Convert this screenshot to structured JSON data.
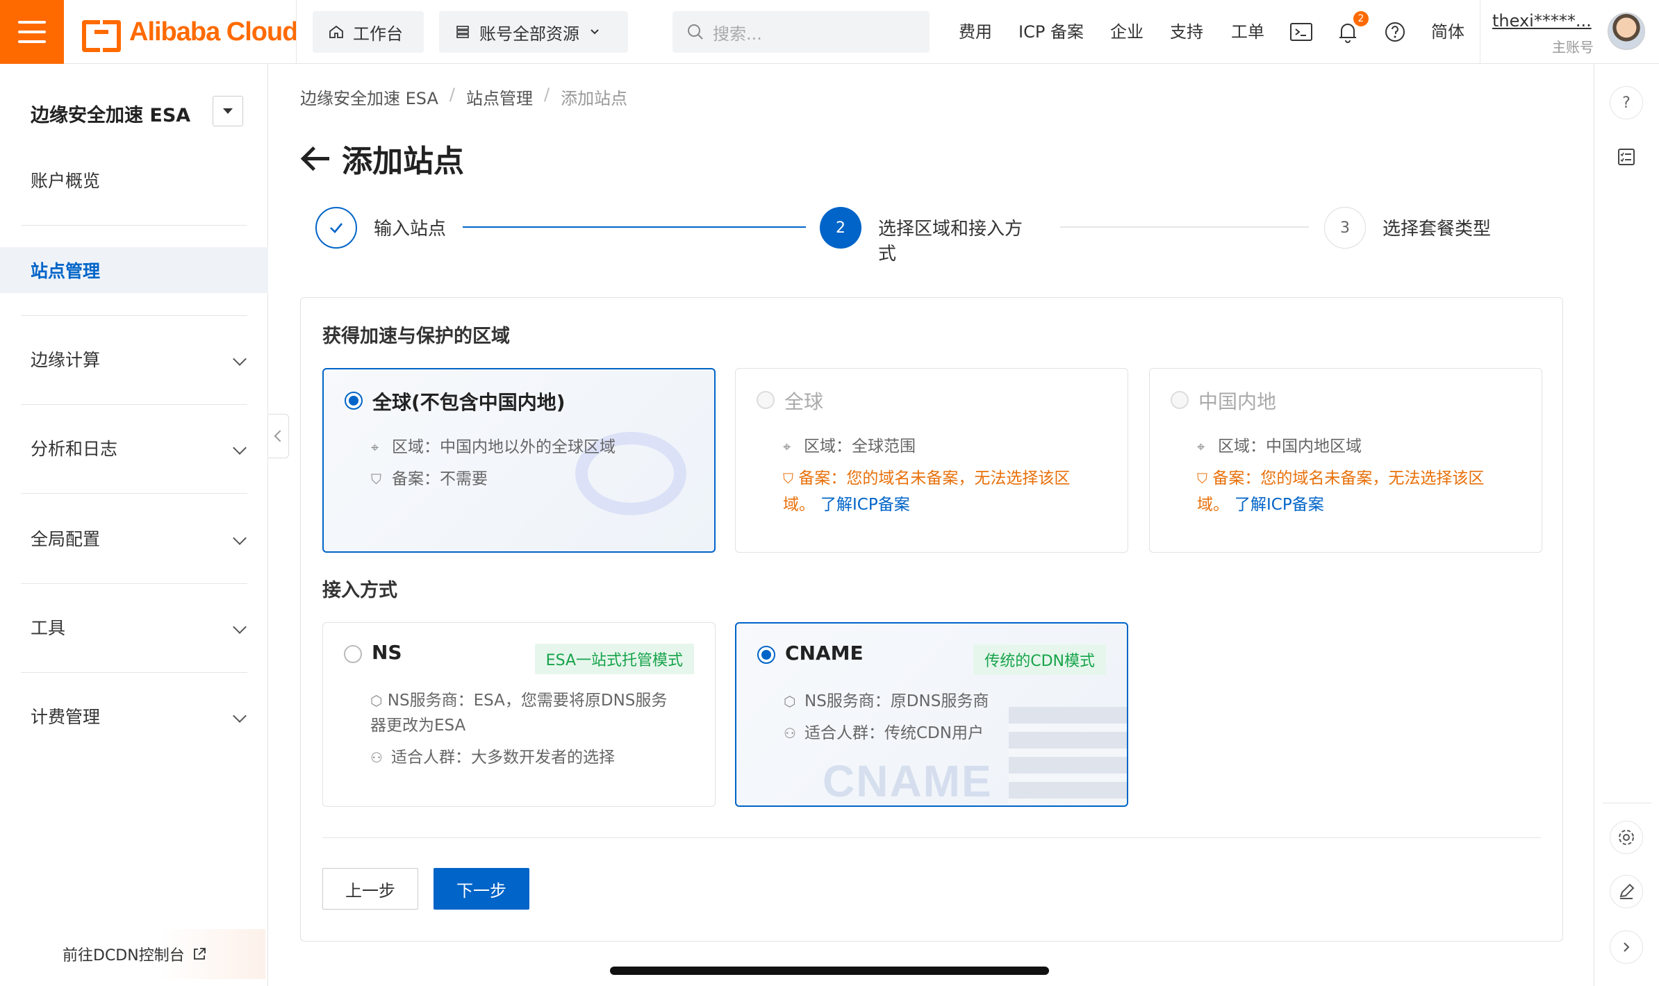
{
  "topbar": {
    "logo_text": "Alibaba Cloud",
    "workbench": "工作台",
    "resources": "账号全部资源",
    "search_placeholder": "搜索...",
    "links": [
      "费用",
      "ICP 备案",
      "企业",
      "支持",
      "工单"
    ],
    "notification_count": "2",
    "language": "简体",
    "user_name": "thexi*****...",
    "user_role": "主账号",
    "accent_color": "#ff6a00"
  },
  "sidebar": {
    "product_title": "边缘安全加速 ESA",
    "items": [
      {
        "label": "账户概览"
      },
      {
        "label": "站点管理",
        "active": true
      },
      {
        "label": "边缘计算"
      },
      {
        "label": "分析和日志"
      },
      {
        "label": "全局配置"
      },
      {
        "label": "工具"
      },
      {
        "label": "计费管理"
      }
    ],
    "dcdn_link": "前往DCDN控制台"
  },
  "breadcrumb": [
    "边缘安全加速 ESA",
    "站点管理",
    "添加站点"
  ],
  "page_title": "添加站点",
  "steps": [
    {
      "label": "输入站点",
      "state": "done"
    },
    {
      "number": "2",
      "label_line1": "选择区域和接入方",
      "label_line2": "式",
      "state": "current"
    },
    {
      "number": "3",
      "label": "选择套餐类型",
      "state": "pending"
    }
  ],
  "region": {
    "title": "获得加速与保护的区域",
    "options": [
      {
        "title": "全球(不包含中国内地)",
        "region_line": "区域：中国内地以外的全球区域",
        "filing_line": "备案：不需要",
        "selected": true
      },
      {
        "title": "全球",
        "region_line": "区域：全球范围",
        "filing_warn": "备案：您的域名未备案，无法选择该区",
        "filing_warn2": "域。",
        "filing_link": "了解ICP备案",
        "disabled": true
      },
      {
        "title": "中国内地",
        "region_line": "区域：中国内地区域",
        "filing_warn": "备案：您的域名未备案，无法选择该区",
        "filing_warn2": "域。",
        "filing_link": "了解ICP备案",
        "disabled": true
      }
    ]
  },
  "access": {
    "title": "接入方式",
    "options": [
      {
        "title": "NS",
        "tag": "ESA一站式托管模式",
        "ns_line1": "NS服务商：ESA，您需要将原DNS服务",
        "ns_line2": "器更改为ESA",
        "audience": "适合人群：大多数开发者的选择",
        "selected": false
      },
      {
        "title": "CNAME",
        "tag": "传统的CDN模式",
        "ns_line1": "NS服务商：原DNS服务商",
        "audience": "适合人群：传统CDN用户",
        "watermark": "CNAME",
        "selected": true
      }
    ]
  },
  "buttons": {
    "prev": "上一步",
    "next": "下一步"
  },
  "colors": {
    "primary": "#0064c8",
    "warning": "#e8700a",
    "tag_green": "#16a34a"
  }
}
